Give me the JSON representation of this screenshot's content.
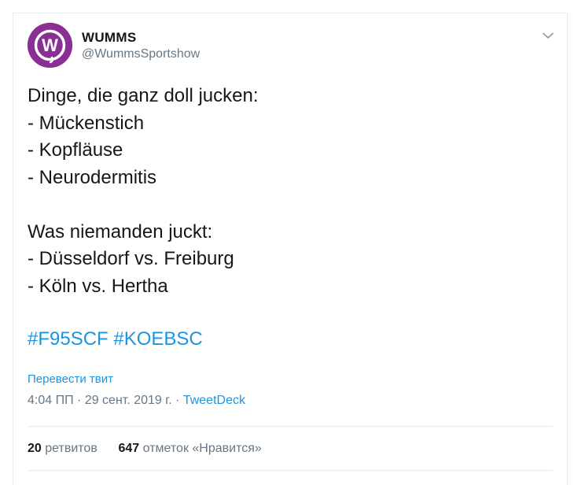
{
  "tweet": {
    "author": {
      "display_name": "WUMMS",
      "handle": "@WummsSportshow",
      "avatar_letter": "W",
      "avatar_color": "#8a2f93"
    },
    "text_lines": [
      "Dinge, die ganz doll jucken:",
      "- Mückenstich",
      "- Kopfläuse",
      "- Neurodermitis",
      "",
      "Was niemanden juckt:",
      "- Düsseldorf vs. Freiburg",
      "- Köln vs. Hertha",
      ""
    ],
    "hashtags": [
      "#F95SCF",
      "#KOEBSC"
    ],
    "translate_label": "Перевести твит",
    "time": "4:04 ПП",
    "date": "29 сент. 2019 г.",
    "separator": " · ",
    "source": "TweetDeck",
    "retweets": {
      "count": "20",
      "label": "ретвитов"
    },
    "likes": {
      "count": "647",
      "label": "отметок «Нравится»"
    },
    "menu_icon": "chevron-down-icon"
  },
  "colors": {
    "link": "#1b95e0",
    "secondary": "#657786",
    "primary_text": "#14171a",
    "border": "#e6ecf0"
  }
}
